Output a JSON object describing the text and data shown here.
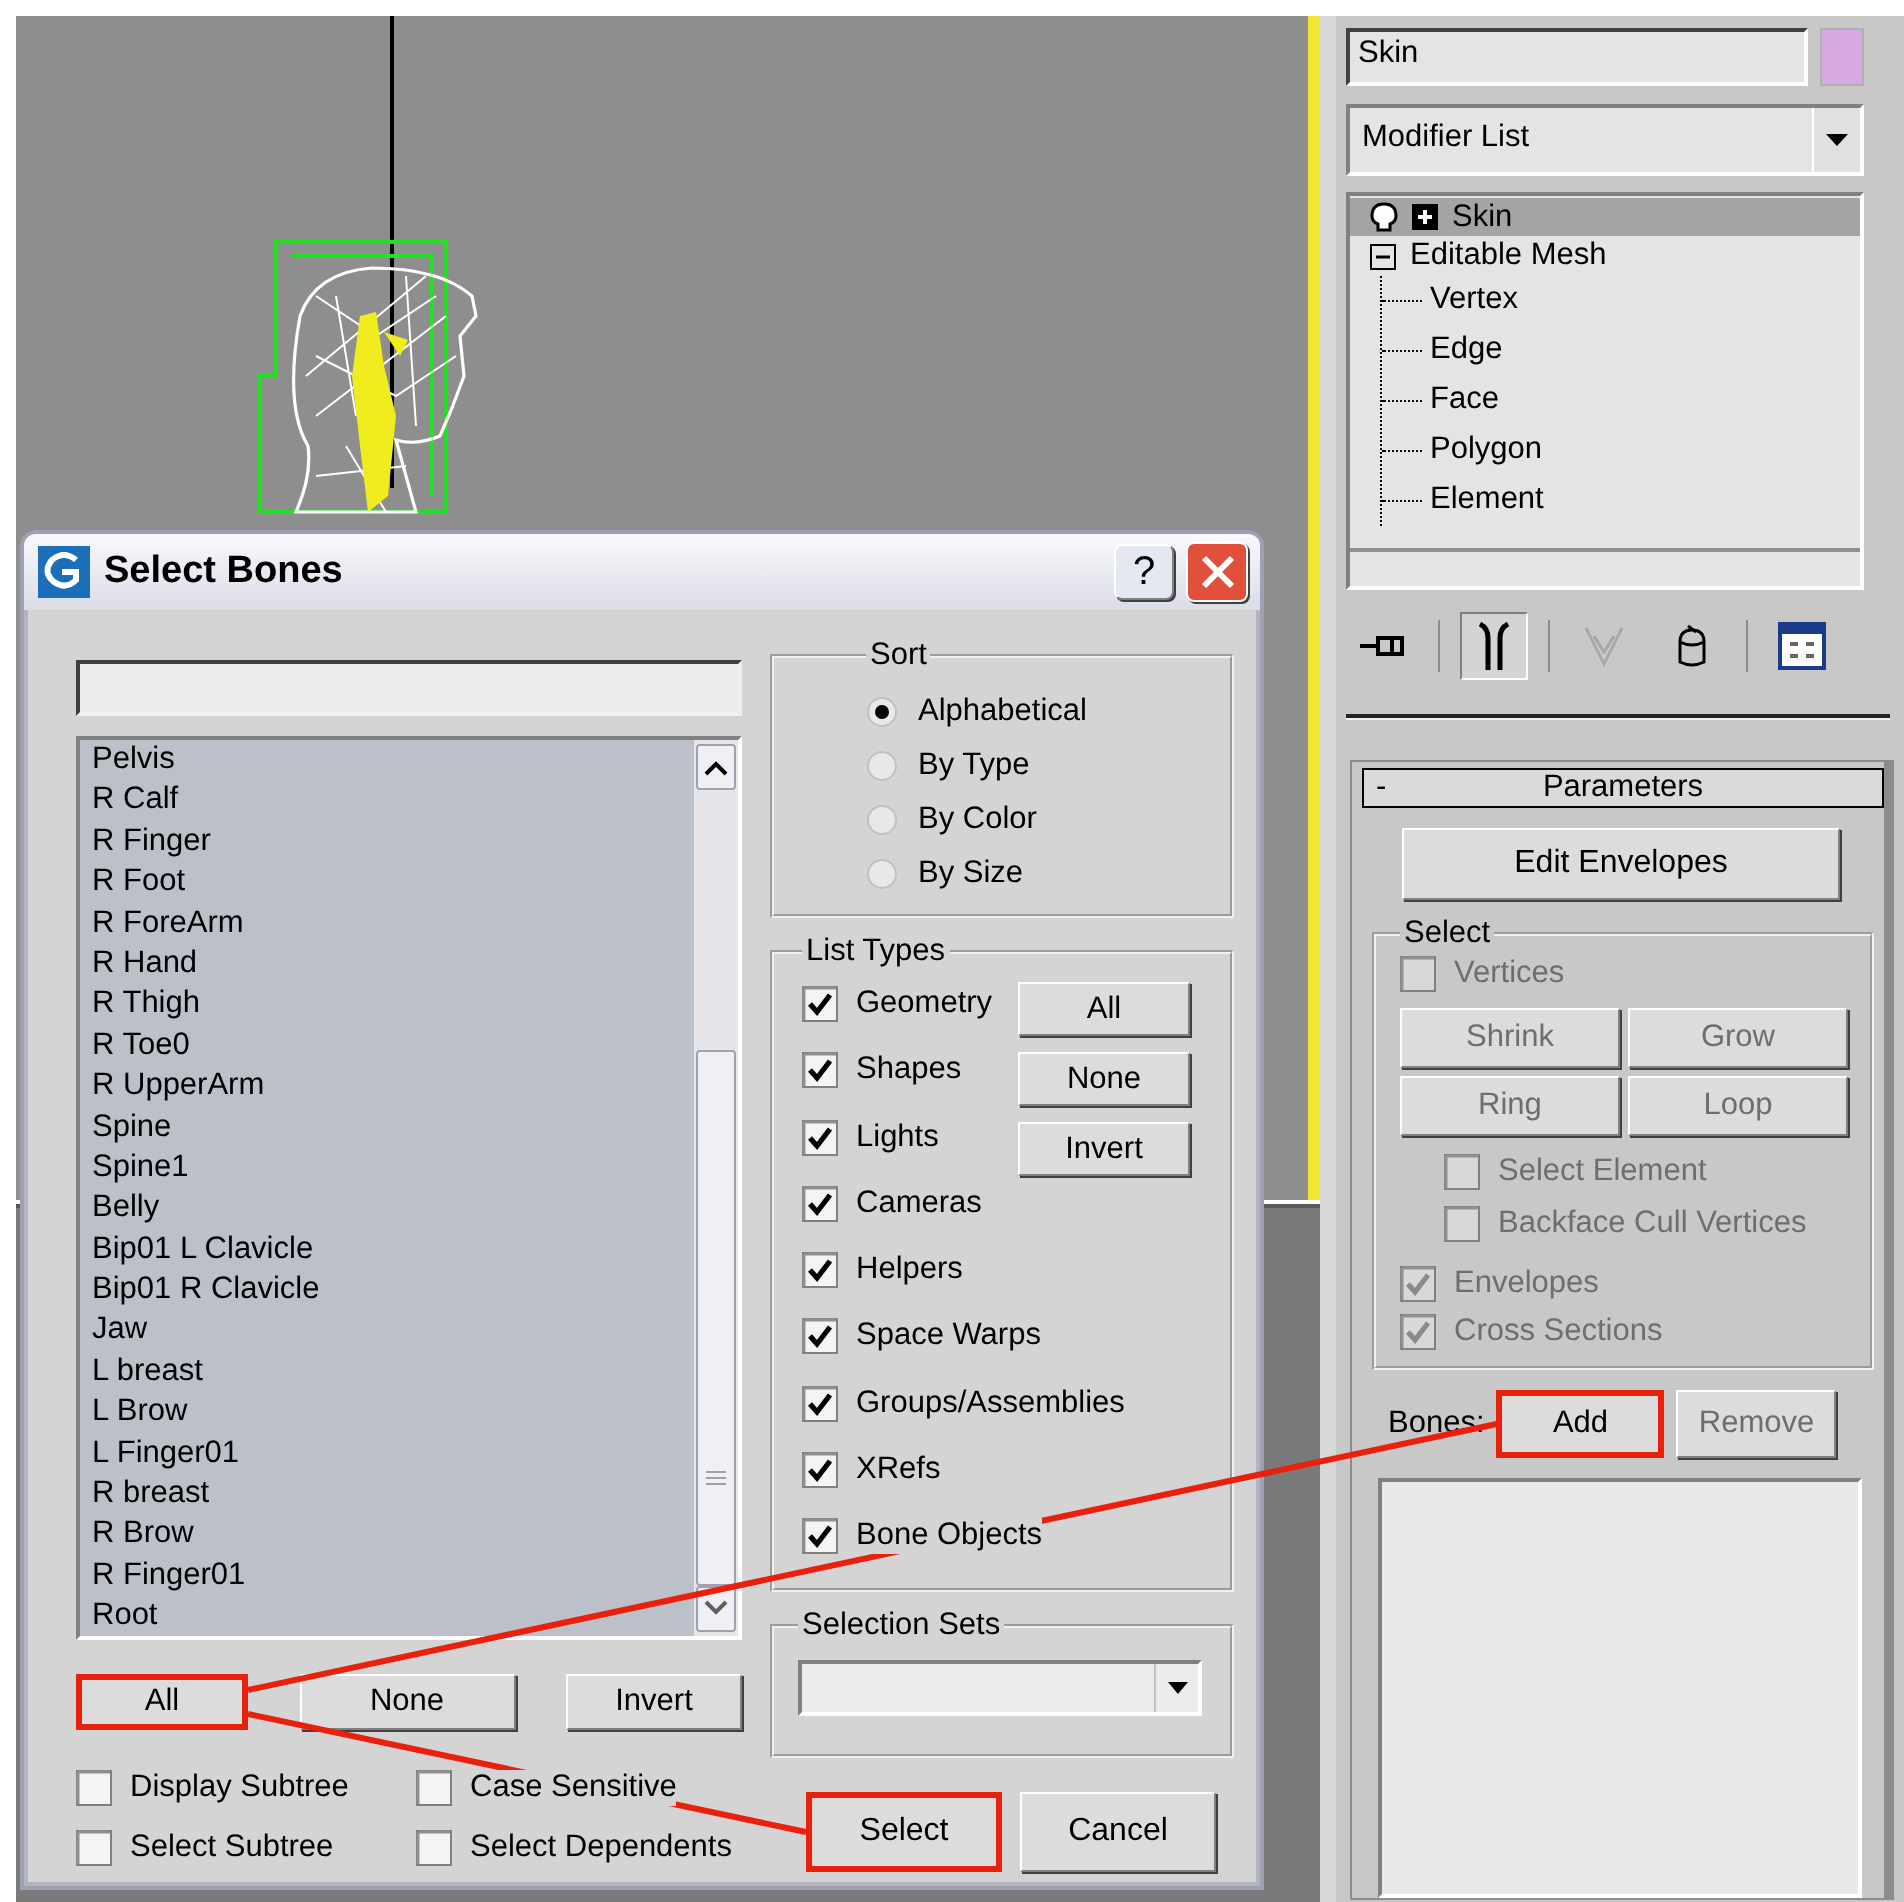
{
  "dialog": {
    "title": "Select Bones",
    "help_label": "?",
    "bones": [
      {
        "name": "Pelvis",
        "selected": false
      },
      {
        "name": "R Calf",
        "selected": false
      },
      {
        "name": "R Finger",
        "selected": false
      },
      {
        "name": "R Foot",
        "selected": false
      },
      {
        "name": "R ForeArm",
        "selected": false
      },
      {
        "name": "R Hand",
        "selected": false
      },
      {
        "name": "R Thigh",
        "selected": false
      },
      {
        "name": "R Toe0",
        "selected": false
      },
      {
        "name": "R UpperArm",
        "selected": false
      },
      {
        "name": "Spine",
        "selected": false
      },
      {
        "name": "Spine1",
        "selected": false
      },
      {
        "name": "Belly",
        "selected": false
      },
      {
        "name": "Bip01 L Clavicle",
        "selected": false
      },
      {
        "name": "Bip01 R Clavicle",
        "selected": false
      },
      {
        "name": "Jaw",
        "selected": false
      },
      {
        "name": "L breast",
        "selected": false
      },
      {
        "name": "L Brow",
        "selected": false
      },
      {
        "name": "L Finger01",
        "selected": false
      },
      {
        "name": "R breast",
        "selected": false
      },
      {
        "name": "R Brow",
        "selected": false
      },
      {
        "name": "R Finger01",
        "selected": false
      },
      {
        "name": "Root",
        "selected": false
      }
    ],
    "list_buttons": [
      {
        "label": "All",
        "highlighted": true
      },
      {
        "label": "None",
        "highlighted": false
      },
      {
        "label": "Invert",
        "highlighted": false
      }
    ],
    "options": [
      {
        "label": "Display Subtree",
        "checked": false
      },
      {
        "label": "Case Sensitive",
        "checked": false
      },
      {
        "label": "Select Subtree",
        "checked": false
      },
      {
        "label": "Select Dependents",
        "checked": false
      }
    ],
    "sort": {
      "title": "Sort",
      "options": [
        {
          "label": "Alphabetical",
          "selected": true
        },
        {
          "label": "By Type",
          "selected": false
        },
        {
          "label": "By Color",
          "selected": false
        },
        {
          "label": "By Size",
          "selected": false
        }
      ]
    },
    "list_types": {
      "title": "List Types",
      "items": [
        {
          "label": "Geometry",
          "checked": true
        },
        {
          "label": "Shapes",
          "checked": true
        },
        {
          "label": "Lights",
          "checked": true
        },
        {
          "label": "Cameras",
          "checked": true
        },
        {
          "label": "Helpers",
          "checked": true
        },
        {
          "label": "Space Warps",
          "checked": true
        },
        {
          "label": "Groups/Assemblies",
          "checked": true
        },
        {
          "label": "XRefs",
          "checked": true
        },
        {
          "label": "Bone Objects",
          "checked": true
        }
      ],
      "buttons": [
        {
          "label": "All"
        },
        {
          "label": "None"
        },
        {
          "label": "Invert"
        }
      ]
    },
    "selection_sets": {
      "title": "Selection Sets"
    },
    "actions": [
      {
        "label": "Select",
        "highlighted": true
      },
      {
        "label": "Cancel",
        "highlighted": false
      }
    ]
  },
  "panel": {
    "object": {
      "name": "Skin",
      "color": "#d8a8e4"
    },
    "modifier_list": "Modifier List",
    "stack": [
      {
        "label": "Skin",
        "kind": "modifier",
        "selected": true,
        "expanded": false
      },
      {
        "label": "Editable Mesh",
        "kind": "object",
        "selected": false,
        "expanded": true,
        "children": [
          {
            "label": "Vertex",
            "selected": false
          },
          {
            "label": "Edge",
            "selected": false
          },
          {
            "label": "Face",
            "selected": false
          },
          {
            "label": "Polygon",
            "selected": false
          },
          {
            "label": "Element",
            "selected": false
          }
        ]
      }
    ],
    "toolbar": [
      {
        "kind": "pin",
        "pressed": false
      },
      {
        "kind": "result",
        "pressed": true
      },
      {
        "kind": "unique",
        "pressed": false
      },
      {
        "kind": "remove",
        "pressed": false
      },
      {
        "kind": "configure",
        "pressed": false
      }
    ],
    "rollout": {
      "collapse_label": "-",
      "title": "Parameters",
      "edit_button": "Edit Envelopes",
      "select_group": {
        "title": "Select",
        "vertices": {
          "label": "Vertices",
          "checked": false,
          "disabled": true
        },
        "buttons": [
          {
            "label": "Shrink",
            "disabled": true
          },
          {
            "label": "Grow",
            "disabled": true
          },
          {
            "label": "Ring",
            "disabled": true
          },
          {
            "label": "Loop",
            "disabled": true
          }
        ],
        "filters": [
          {
            "label": "Select Element",
            "checked": false,
            "disabled": true
          },
          {
            "label": "Backface Cull Vertices",
            "checked": false,
            "disabled": true
          }
        ],
        "display": [
          {
            "label": "Envelopes",
            "checked": true,
            "disabled": true
          },
          {
            "label": "Cross Sections",
            "checked": true,
            "disabled": true
          }
        ]
      },
      "bones_label": "Bones:",
      "bones_buttons": [
        {
          "label": "Add",
          "highlighted": true,
          "disabled": false
        },
        {
          "label": "Remove",
          "highlighted": false,
          "disabled": true
        }
      ]
    }
  }
}
